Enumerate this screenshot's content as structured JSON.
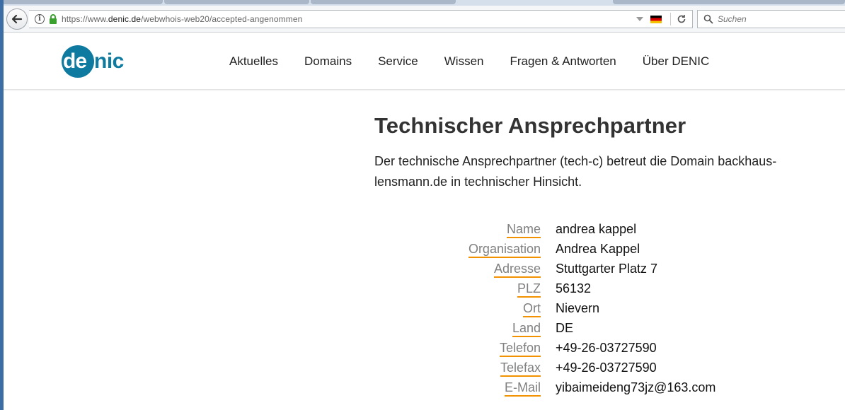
{
  "browser": {
    "url_prefix": "https://www.",
    "url_host": "denic.de",
    "url_path": "/webwhois-web20/accepted-angenommen",
    "search_placeholder": "Suchen"
  },
  "site": {
    "logo_de": "de",
    "logo_nic": "nic",
    "nav": [
      "Aktuelles",
      "Domains",
      "Service",
      "Wissen",
      "Fragen & Antworten",
      "Über DENIC"
    ]
  },
  "main": {
    "title": "Technischer Ansprechpartner",
    "intro": "Der technische Ansprechpartner (tech-c) betreut die Domain backhaus-lensmann.de in technischer Hinsicht."
  },
  "details": [
    {
      "label": "Name",
      "value": "andrea kappel"
    },
    {
      "label": "Organisation",
      "value": "Andrea Kappel"
    },
    {
      "label": "Adresse",
      "value": "Stuttgarter Platz 7"
    },
    {
      "label": "PLZ",
      "value": "56132"
    },
    {
      "label": "Ort",
      "value": "Nievern"
    },
    {
      "label": "Land",
      "value": "DE"
    },
    {
      "label": "Telefon",
      "value": "+49-26-03727590"
    },
    {
      "label": "Telefax",
      "value": "+49-26-03727590"
    },
    {
      "label": "E-Mail",
      "value": "yibaimeideng73jz@163.com"
    }
  ],
  "colors": {
    "brand": "#0e7aa0",
    "label_underline": "#f39200"
  }
}
